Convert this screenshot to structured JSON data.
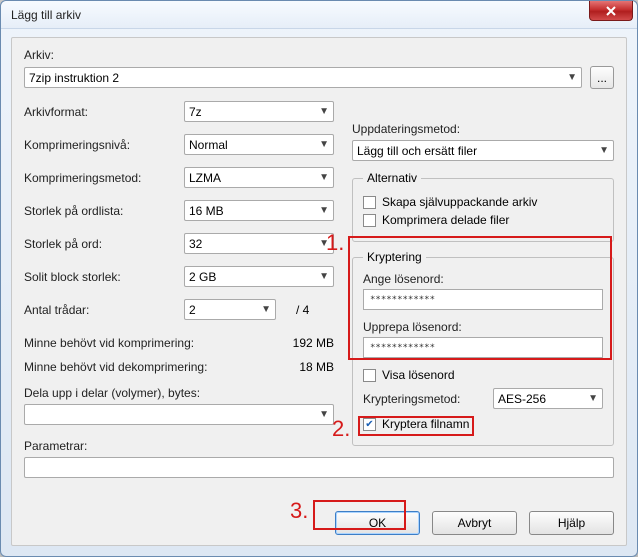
{
  "title": "Lägg till arkiv",
  "archive": {
    "label": "Arkiv:",
    "value": "7zip instruktion 2",
    "browse": "..."
  },
  "left": {
    "format_label": "Arkivformat:",
    "format_value": "7z",
    "complevel_label": "Komprimeringsnivå:",
    "complevel_value": "Normal",
    "compmethod_label": "Komprimeringsmetod:",
    "compmethod_value": "LZMA",
    "dictsize_label": "Storlek på ordlista:",
    "dictsize_value": "16 MB",
    "wordsize_label": "Storlek på ord:",
    "wordsize_value": "32",
    "solidblock_label": "Solit block storlek:",
    "solidblock_value": "2 GB",
    "threads_label": "Antal trådar:",
    "threads_value": "2",
    "threads_max": "/ 4",
    "memcomp_label": "Minne behövt vid komprimering:",
    "memcomp_value": "192 MB",
    "memdecomp_label": "Minne behövt vid dekomprimering:",
    "memdecomp_value": "18 MB",
    "split_label": "Dela upp i delar (volymer), bytes:",
    "split_value": "",
    "params_label": "Parametrar:",
    "params_value": ""
  },
  "right": {
    "update_label": "Uppdateringsmetod:",
    "update_value": "Lägg till och ersätt filer",
    "options_legend": "Alternativ",
    "sfx_label": "Skapa självuppackande arkiv",
    "sfx_checked": false,
    "shared_label": "Komprimera delade filer",
    "shared_checked": false,
    "enc_legend": "Kryptering",
    "pwd1_label": "Ange lösenord:",
    "pwd1_value": "************",
    "pwd2_label": "Upprepa lösenord:",
    "pwd2_value": "************",
    "showpwd_label": "Visa lösenord",
    "showpwd_checked": false,
    "encmethod_label": "Krypteringsmetod:",
    "encmethod_value": "AES-256",
    "encnames_label": "Kryptera filnamn",
    "encnames_checked": true
  },
  "buttons": {
    "ok": "OK",
    "cancel": "Avbryt",
    "help": "Hjälp"
  },
  "annotations": {
    "a1": "1.",
    "a2": "2.",
    "a3": "3."
  }
}
